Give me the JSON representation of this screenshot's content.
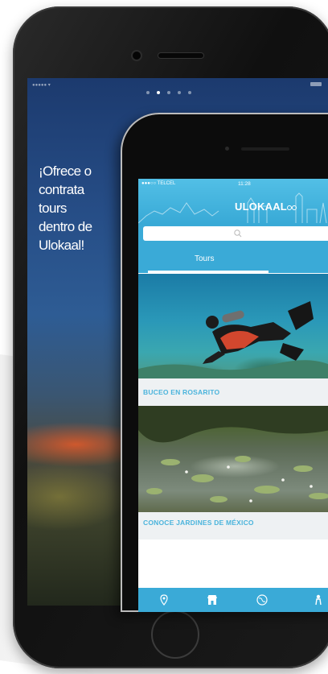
{
  "promo": {
    "tagline": "¡Ofrece o\ncontrata\ntours\ndentro de\nUlokaal!",
    "page_indicator": {
      "count": 5,
      "active_index": 1
    }
  },
  "app": {
    "status_bar": {
      "carrier": "●●●○○ TELCEL",
      "time": "11:28"
    },
    "logo": "ULOKAAL",
    "search": {
      "placeholder": ""
    },
    "tabs": [
      {
        "label": "Tours",
        "selected": true
      },
      {
        "label": ""
      }
    ],
    "cards": [
      {
        "title": "BUCEO EN ROSARITO",
        "image": "scuba-diver"
      },
      {
        "title": "CONOCE JARDINES DE MÉXICO",
        "image": "garden-lily-pond"
      }
    ],
    "bottom_nav": [
      {
        "icon": "location-pin-icon"
      },
      {
        "icon": "store-icon",
        "active": true
      },
      {
        "icon": "globe-icon"
      },
      {
        "icon": "person-icon"
      }
    ]
  },
  "colors": {
    "accent": "#3aaad7",
    "card_title": "#4bb4dc",
    "card_bg": "#eef1f3"
  }
}
